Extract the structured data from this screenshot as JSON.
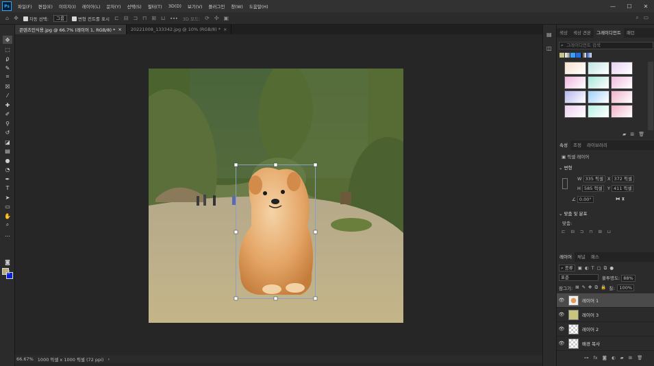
{
  "menubar": {
    "app_icon": "Ps",
    "items": [
      "파일(F)",
      "편집(E)",
      "이미지(I)",
      "레이어(L)",
      "문자(Y)",
      "선택(S)",
      "필터(T)",
      "3D(D)",
      "보기(V)",
      "플러그인",
      "창(W)",
      "도움말(H)"
    ],
    "minimize": "—",
    "maximize": "☐",
    "close": "✕"
  },
  "options": {
    "auto_select_label": "자동 선택:",
    "auto_select_value": "그룹",
    "transform_label": "변형 컨트롤 표시",
    "more": "•••",
    "mode_3d": "3D 모드:"
  },
  "tabs": [
    {
      "label": "콘텐츠인식용.jpg @ 66.7% (레이어 1, RGB/8) *",
      "active": true
    },
    {
      "label": "20221008_133342.jpg @ 10% (RGB/8) *",
      "active": false
    }
  ],
  "status": {
    "zoom": "66.67%",
    "doc_size": "1000 픽셀 x 1000 픽셀 (72 ppi)",
    "arrow": "›"
  },
  "panels": {
    "top_tabs": [
      "색상",
      "색상 견본",
      "그레이디언트",
      "패턴"
    ],
    "search_placeholder": "그레이디언트 검색",
    "gradient_colors": [
      [
        "#f7e1d0",
        "#bfe7e2",
        "#e8d0f4"
      ],
      [
        "#f0b8e0",
        "#a8e7d8",
        "#f1bce0"
      ],
      [
        "#b6b7f0",
        "#9fd0f7",
        "#f0b2cc"
      ],
      [
        "#f0d0f0",
        "#b7f2e4",
        "#f3b1c8"
      ]
    ],
    "props_tabs": [
      "속성",
      "조정",
      "라이브러리"
    ],
    "pixel_layer": "픽셀 레이어",
    "transform_title": "변형",
    "w": "335 픽셀",
    "x": "372 픽셀",
    "h": "585 픽셀",
    "y": "411 픽셀",
    "angle": "0.00°",
    "align_title": "맞춤 및 분포",
    "align_label": "맞춤:",
    "layer_tabs": [
      "레이어",
      "채널",
      "패스"
    ],
    "kind": "종류",
    "blend": "표준",
    "opacity_label": "불투명도:",
    "opacity": "88%",
    "lock_label": "잠그기:",
    "fill_label": "칠:",
    "fill": "100%",
    "layers": [
      {
        "name": "레이어 1",
        "selected": true,
        "thumb": "dog"
      },
      {
        "name": "레이어 3",
        "selected": false,
        "thumb": "khaki"
      },
      {
        "name": "레이어 2",
        "selected": false,
        "thumb": "checker"
      },
      {
        "name": "배경 복사",
        "selected": false,
        "thumb": "checker"
      }
    ]
  }
}
